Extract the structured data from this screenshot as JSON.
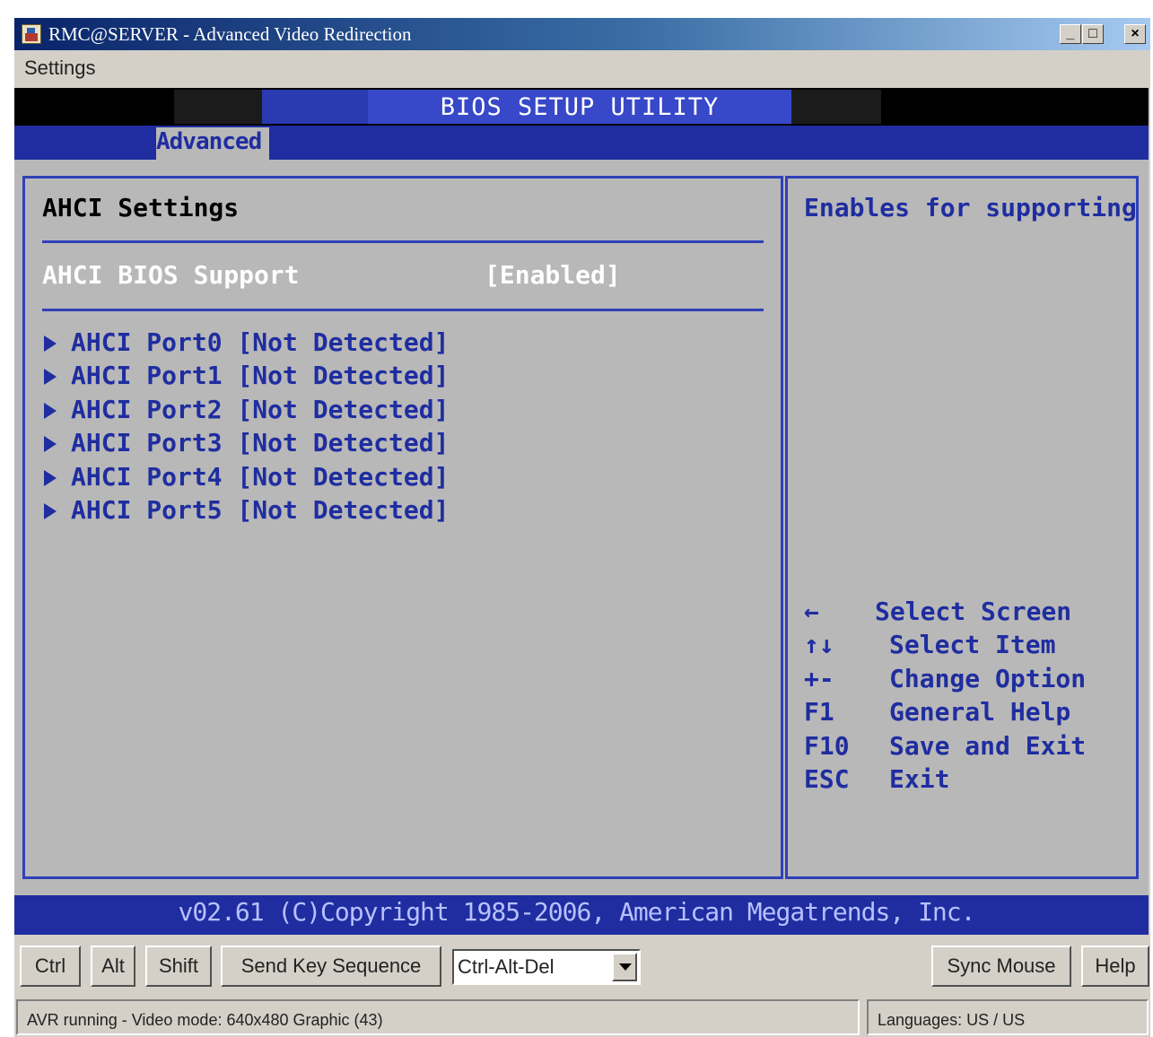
{
  "window": {
    "title": "RMC@SERVER - Advanced Video Redirection",
    "minimize": "_",
    "maximize": "□",
    "close": "×"
  },
  "menubar": {
    "settings": "Settings"
  },
  "bios": {
    "title": "BIOS SETUP UTILITY",
    "active_tab": "Advanced",
    "section_title": "AHCI Settings",
    "option": {
      "label": "AHCI BIOS Support",
      "value": "[Enabled]"
    },
    "ports": [
      "AHCI Port0 [Not Detected]",
      "AHCI Port1 [Not Detected]",
      "AHCI Port2 [Not Detected]",
      "AHCI Port3 [Not Detected]",
      "AHCI Port4 [Not Detected]",
      "AHCI Port5 [Not Detected]"
    ],
    "help_text": "Enables for supporting",
    "keys": [
      {
        "key": "←",
        "desc": "Select Screen"
      },
      {
        "key": "↑↓",
        "desc": "Select Item"
      },
      {
        "key": "+-",
        "desc": "Change Option"
      },
      {
        "key": "F1",
        "desc": "General Help"
      },
      {
        "key": "F10",
        "desc": "Save and Exit"
      },
      {
        "key": "ESC",
        "desc": "Exit"
      }
    ],
    "copyright": "v02.61 (C)Copyright 1985-2006, American Megatrends, Inc."
  },
  "toolbar": {
    "ctrl": "Ctrl",
    "alt": "Alt",
    "shift": "Shift",
    "send_key_sequence": "Send Key Sequence",
    "sequence_selected": "Ctrl-Alt-Del",
    "sync_mouse": "Sync Mouse",
    "help": "Help"
  },
  "status": {
    "left": "AVR running - Video mode: 640x480 Graphic (43)",
    "right": "Languages: US / US"
  },
  "colors": {
    "bios_blue": "#1f2da0",
    "bios_gray": "#b8b8b8",
    "window_gray": "#d4d0c8"
  }
}
